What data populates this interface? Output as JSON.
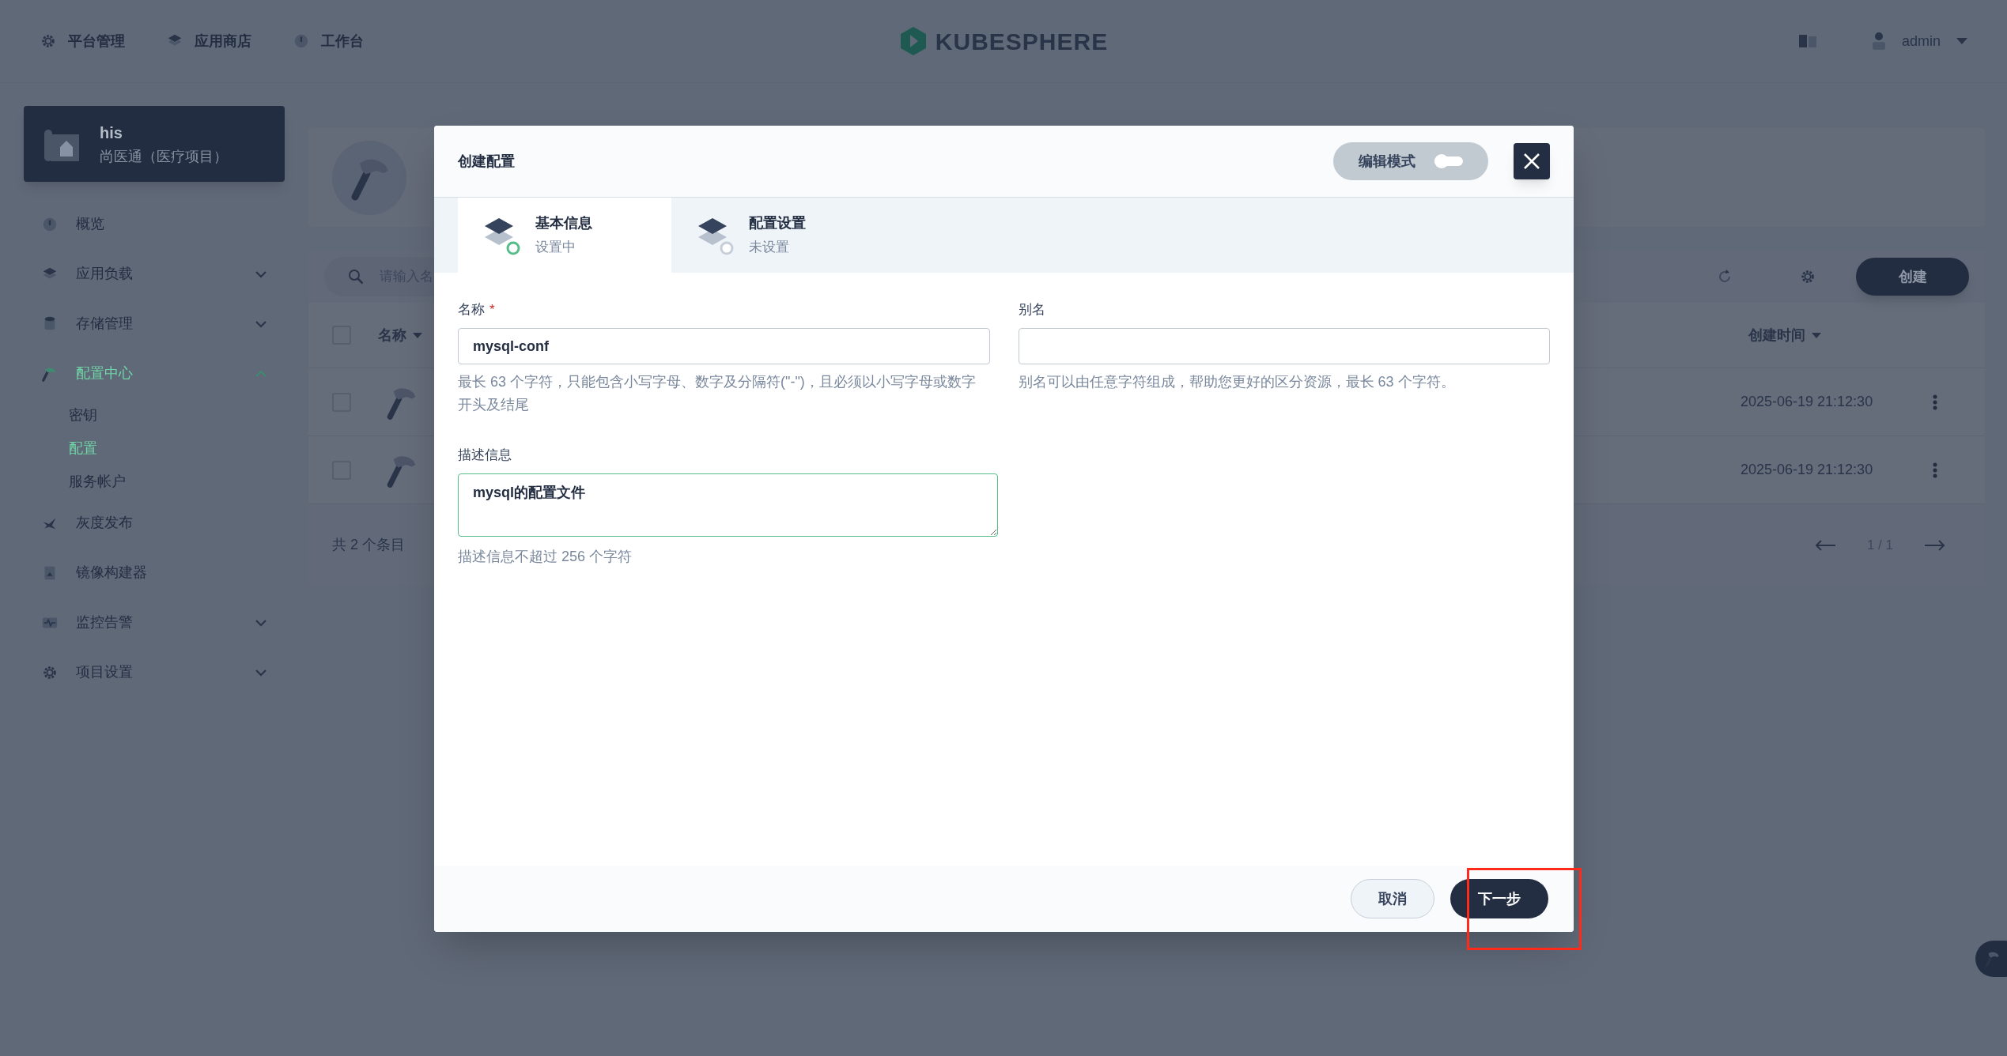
{
  "topbar": {
    "nav": [
      {
        "label": "平台管理",
        "kind": "gear"
      },
      {
        "label": "应用商店",
        "kind": "layers"
      },
      {
        "label": "工作台",
        "kind": "dial"
      }
    ],
    "logo": "KUBESPHERE",
    "user": "admin"
  },
  "sidebar": {
    "project": {
      "name": "his",
      "description": "尚医通（医疗项目）"
    },
    "items": [
      {
        "label": "概览",
        "kind": "dial",
        "expandable": false,
        "selected": false
      },
      {
        "label": "应用负载",
        "kind": "layers",
        "expandable": true,
        "expanded": false,
        "selected": false
      },
      {
        "label": "存储管理",
        "kind": "database",
        "expandable": true,
        "expanded": false,
        "selected": false
      },
      {
        "label": "配置中心",
        "kind": "hammer",
        "expandable": true,
        "expanded": true,
        "selected": true,
        "children": [
          {
            "label": "密钥",
            "selected": false
          },
          {
            "label": "配置",
            "selected": true
          },
          {
            "label": "服务帐户",
            "selected": false
          }
        ]
      },
      {
        "label": "灰度发布",
        "kind": "bird",
        "expandable": false,
        "selected": false
      },
      {
        "label": "镜像构建器",
        "kind": "image",
        "expandable": false,
        "selected": false
      },
      {
        "label": "监控告警",
        "kind": "pulse",
        "expandable": true,
        "expanded": false,
        "selected": false
      },
      {
        "label": "项目设置",
        "kind": "gear",
        "expandable": true,
        "expanded": false,
        "selected": false
      }
    ]
  },
  "page": {
    "search": {
      "placeholder": "请输入名"
    },
    "create_button": "创建",
    "select_all": {
      "checked": false
    },
    "columns": [
      "名称",
      "创建时间"
    ],
    "rows": [
      {
        "checked": false,
        "created": "2025-06-19 21:12:30"
      },
      {
        "checked": false,
        "created": "2025-06-19 21:12:30"
      }
    ],
    "total": "共 2 个条目",
    "pagination": "1 / 1"
  },
  "modal": {
    "title": "创建配置",
    "edit_mode": {
      "label": "编辑模式",
      "on": false
    },
    "steps": [
      {
        "title": "基本信息",
        "status": "设置中",
        "selected": true
      },
      {
        "title": "配置设置",
        "status": "未设置",
        "selected": false
      }
    ],
    "name": {
      "label": "名称",
      "required_mark": "*",
      "value": "mysql-conf",
      "hint": "最长 63 个字符，只能包含小写字母、数字及分隔符(\"-\")，且必须以小写字母或数字开头及结尾"
    },
    "alias": {
      "label": "别名",
      "hint": "别名可以由任意字符组成，帮助您更好的区分资源，最长 63 个字符。"
    },
    "description": {
      "label": "描述信息",
      "value": "mysql的配置文件",
      "hint": "描述信息不超过 256 个字符"
    },
    "buttons": [
      {
        "label": "取消",
        "kind": "secondary"
      },
      {
        "label": "下一步",
        "kind": "primary",
        "highlighted": true
      }
    ]
  }
}
